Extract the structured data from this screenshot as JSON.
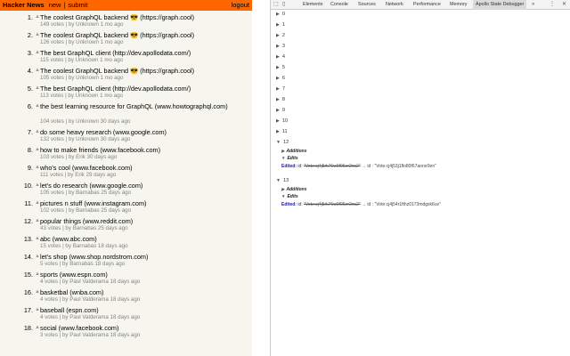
{
  "hn": {
    "brand": "Hacker News",
    "nav": {
      "new": "new",
      "sep": "|",
      "submit": "submit"
    },
    "logout": "logout",
    "items": [
      {
        "rank": "1.",
        "title": "The coolest GraphQL backend 😎 (https://graph.cool)",
        "meta": "149 votes | by Unknown 1 mo ago"
      },
      {
        "rank": "2.",
        "title": "The coolest GraphQL backend 😎 (https://graph.cool)",
        "meta": "126 votes | by Unknown 1 mo ago"
      },
      {
        "rank": "3.",
        "title": "The best GraphQL client (http://dev.apollodata.com/)",
        "meta": "115 votes | by Unknown 1 mo ago"
      },
      {
        "rank": "4.",
        "title": "The coolest GraphQL backend 😎 (https://graph.cool)",
        "meta": "105 votes | by Unknown 1 mo ago"
      },
      {
        "rank": "5.",
        "title": "The best GraphQL client (http://dev.apollodata.com/)",
        "meta": "113 votes | by Unknown 1 mo ago"
      },
      {
        "rank": "6.",
        "title": "the best learning resource for GraphQL (www.howtographql.com)",
        "meta": "104 votes | by Unknown 30 days ago"
      },
      {
        "rank": "7.",
        "title": "do some heavy research (www.google.com)",
        "meta": "132 votes | by Unknown 30 days ago"
      },
      {
        "rank": "8.",
        "title": "how to make friends (www.facebook.com)",
        "meta": "103 votes | by Erik 30 days ago"
      },
      {
        "rank": "9.",
        "title": "who's cool (www.facebook.com)",
        "meta": "111 votes | by Erik 29 days ago"
      },
      {
        "rank": "10.",
        "title": "let's do research (www.google.com)",
        "meta": "105 votes | by Barnabas 25 days ago"
      },
      {
        "rank": "11.",
        "title": "pictures n stuff (www.instagram.com)",
        "meta": "102 votes | by Barnabas 25 days ago"
      },
      {
        "rank": "12.",
        "title": "popular things (www.reddit.com)",
        "meta": "43 votes | by Barnabas 25 days ago"
      },
      {
        "rank": "13.",
        "title": "abc (www.abc.com)",
        "meta": "15 votes | by Barnabas 18 days ago"
      },
      {
        "rank": "14.",
        "title": "let's shop (www.shop.nordstrom.com)",
        "meta": "5 votes | by Barnabas 18 days ago"
      },
      {
        "rank": "15.",
        "title": "sports (www.espn.com)",
        "meta": "4 votes | by Paul Valderama 18 days ago"
      },
      {
        "rank": "16.",
        "title": "basketbal (wnba.com)",
        "meta": "4 votes | by Paul Valderama 18 days ago"
      },
      {
        "rank": "17.",
        "title": "baseball (espn.com)",
        "meta": "4 votes | by Paul Valderama 18 days ago"
      },
      {
        "rank": "18.",
        "title": "social (www.facebook.com)",
        "meta": "3 votes | by Paul Valderama 18 days ago"
      }
    ]
  },
  "devtools": {
    "tabs": [
      "Elements",
      "Console",
      "Sources",
      "Network",
      "Performance",
      "Memory",
      "Apollo State Debugger"
    ],
    "more": "»",
    "menu": "⋮",
    "close": "✕",
    "rows": [
      "0",
      "1",
      "2",
      "3",
      "4",
      "5",
      "6",
      "7",
      "8",
      "9",
      "10",
      "11",
      "12",
      "13"
    ],
    "expanded": {
      "additions_label": "Additions",
      "edits_label": "Edits",
      "edited_label": "Edited:",
      "id_key": "id:",
      "arrow": "→",
      "entry12": {
        "old": "\"Vote:cj4j5rk76w0f06er2ns2\"",
        "new": "id : \"Vote:cj4j53j1flo80f67aorsr0en\""
      },
      "entry13": {
        "old": "\"Vote:cj4j5rk76w0f06er2ns2\"",
        "new": "id : \"Vote:cj4j54r1fthz0173mdgxk6uv\""
      }
    }
  }
}
